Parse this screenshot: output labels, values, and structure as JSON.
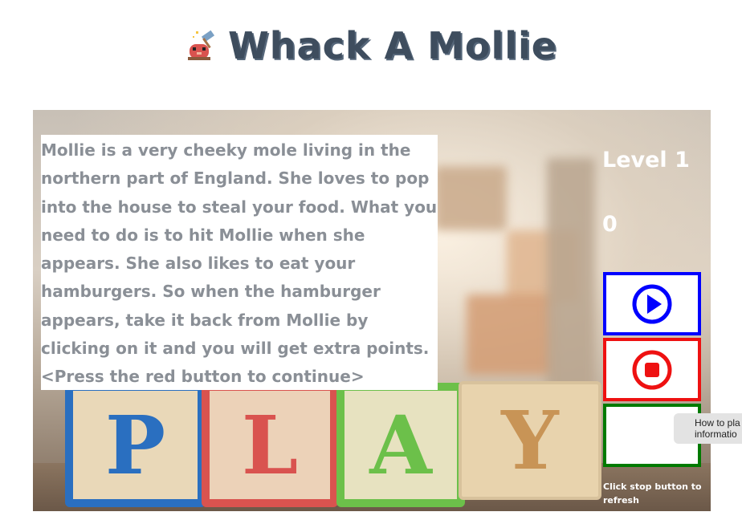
{
  "header": {
    "title": "Whack A Mollie",
    "icon": "mole-with-hammer-icon"
  },
  "intro": {
    "lines": [
      "Mollie is a very cheeky mole living in the",
      "northern part of England. She loves to pop",
      "into the house to steal your food. What you",
      "need to do is to hit Mollie when she",
      "appears. She also likes to eat your",
      "hamburgers. So when the hamburger",
      "appears, take it back from Mollie by",
      "clicking on it and you will get extra points.",
      "<Press the red button to continue>"
    ]
  },
  "background": {
    "blocks": [
      "P",
      "L",
      "A",
      "Y"
    ]
  },
  "hud": {
    "level": "Level 1",
    "score": "0"
  },
  "controls": {
    "play_icon": "play-icon",
    "stop_icon": "stop-icon",
    "stop_hint": "Click stop button to refresh",
    "info_tooltip": "How to pla\ninformatio"
  },
  "colors": {
    "title": "#3e4d5e",
    "play_border": "#0000ff",
    "stop_border": "#ee1111",
    "info_border": "#007a00",
    "intro_text": "#8a8f96"
  }
}
